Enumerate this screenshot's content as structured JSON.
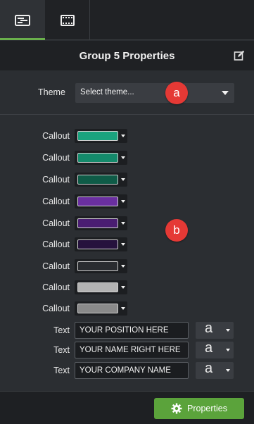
{
  "tabs": [
    {
      "icon": "properties-panel-icon",
      "active": true
    },
    {
      "icon": "film-strip-icon",
      "active": false
    }
  ],
  "panel": {
    "title": "Group 5 Properties",
    "edit_icon": "edit-icon"
  },
  "theme": {
    "label": "Theme",
    "value": "Select theme...",
    "marker": "a"
  },
  "callouts": [
    {
      "label": "Callout",
      "color": "#1aa37e"
    },
    {
      "label": "Callout",
      "color": "#148a6b"
    },
    {
      "label": "Callout",
      "color": "#0f5b47"
    },
    {
      "label": "Callout",
      "color": "#6a2fa0"
    },
    {
      "label": "Callout",
      "color": "#4a1d72"
    },
    {
      "label": "Callout",
      "color": "#26123d"
    },
    {
      "label": "Callout",
      "color": "#2a2c30"
    },
    {
      "label": "Callout",
      "color": "#b3b3b3"
    },
    {
      "label": "Callout",
      "color": "#8a8a8a"
    }
  ],
  "marker_b": "b",
  "text_fields": [
    {
      "label": "Text",
      "value": "YOUR POSITION HERE",
      "font_glyph": "a"
    },
    {
      "label": "Text",
      "value": "YOUR NAME RIGHT HERE",
      "font_glyph": "a"
    },
    {
      "label": "Text",
      "value": "YOUR COMPANY NAME",
      "font_glyph": "a"
    }
  ],
  "footer": {
    "properties_label": "Properties",
    "accent": "#5ba33b"
  }
}
